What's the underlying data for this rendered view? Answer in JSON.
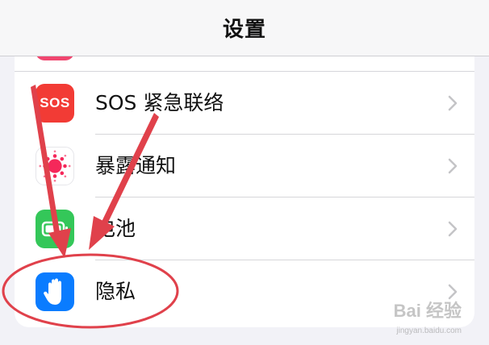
{
  "header": {
    "title": "设置"
  },
  "settings": {
    "rows": [
      {
        "label": "SOS 紧急联络",
        "icon": "sos-icon",
        "icon_text": "SOS",
        "icon_color": "#f23b35"
      },
      {
        "label": "暴露通知",
        "icon": "exposure-notification-icon",
        "icon_color": "#ffffff"
      },
      {
        "label": "电池",
        "icon": "battery-icon",
        "icon_color": "#34c759"
      },
      {
        "label": "隐私",
        "icon": "privacy-hand-icon",
        "icon_color": "#0a7cff"
      }
    ]
  },
  "annotation": {
    "color": "#e0414b"
  },
  "watermark": {
    "brand": "Bai 经验",
    "url": "jingyan.baidu.com"
  }
}
